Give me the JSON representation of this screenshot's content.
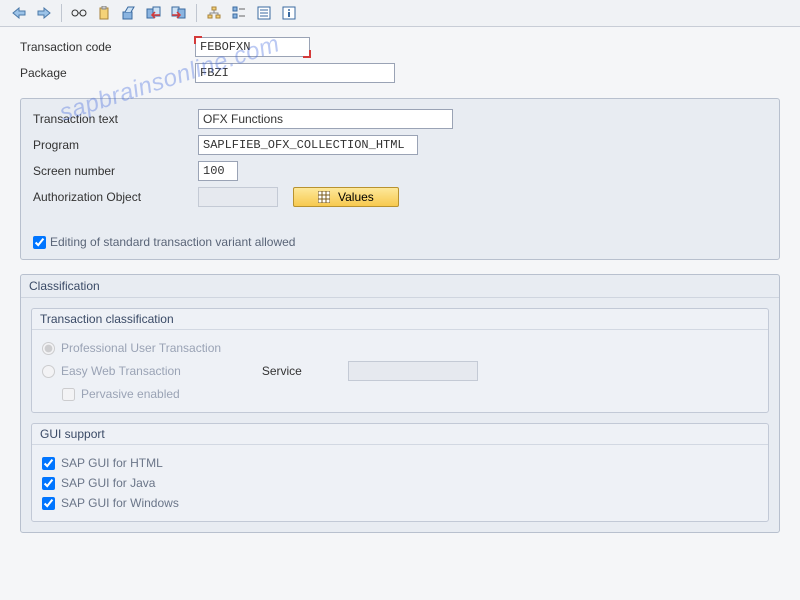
{
  "toolbar": {
    "icons": [
      "back",
      "forward",
      "glasses",
      "clipboard",
      "cut",
      "copy-left",
      "copy-right",
      "hierarchy",
      "align",
      "list",
      "info"
    ]
  },
  "header": {
    "tcode_label": "Transaction code",
    "tcode_value": "FEBOFXN",
    "package_label": "Package",
    "package_value": "FBZI"
  },
  "details": {
    "text_label": "Transaction text",
    "text_value": "OFX Functions",
    "program_label": "Program",
    "program_value": "SAPLFIEB_OFX_COLLECTION_HTML",
    "screen_label": "Screen number",
    "screen_value": "100",
    "auth_label": "Authorization Object",
    "auth_value": "",
    "values_btn": "Values",
    "edit_variant_label": "Editing of standard transaction variant allowed",
    "edit_variant_checked": true
  },
  "classification": {
    "title": "Classification",
    "trans_class_title": "Transaction classification",
    "professional_label": "Professional User Transaction",
    "easy_web_label": "Easy Web Transaction",
    "service_label": "Service",
    "service_value": "",
    "pervasive_label": "Pervasive enabled",
    "gui_title": "GUI support",
    "gui_html": "SAP GUI for HTML",
    "gui_java": "SAP GUI for Java",
    "gui_windows": "SAP GUI for Windows"
  },
  "watermark": "sapbrainsonline.com"
}
